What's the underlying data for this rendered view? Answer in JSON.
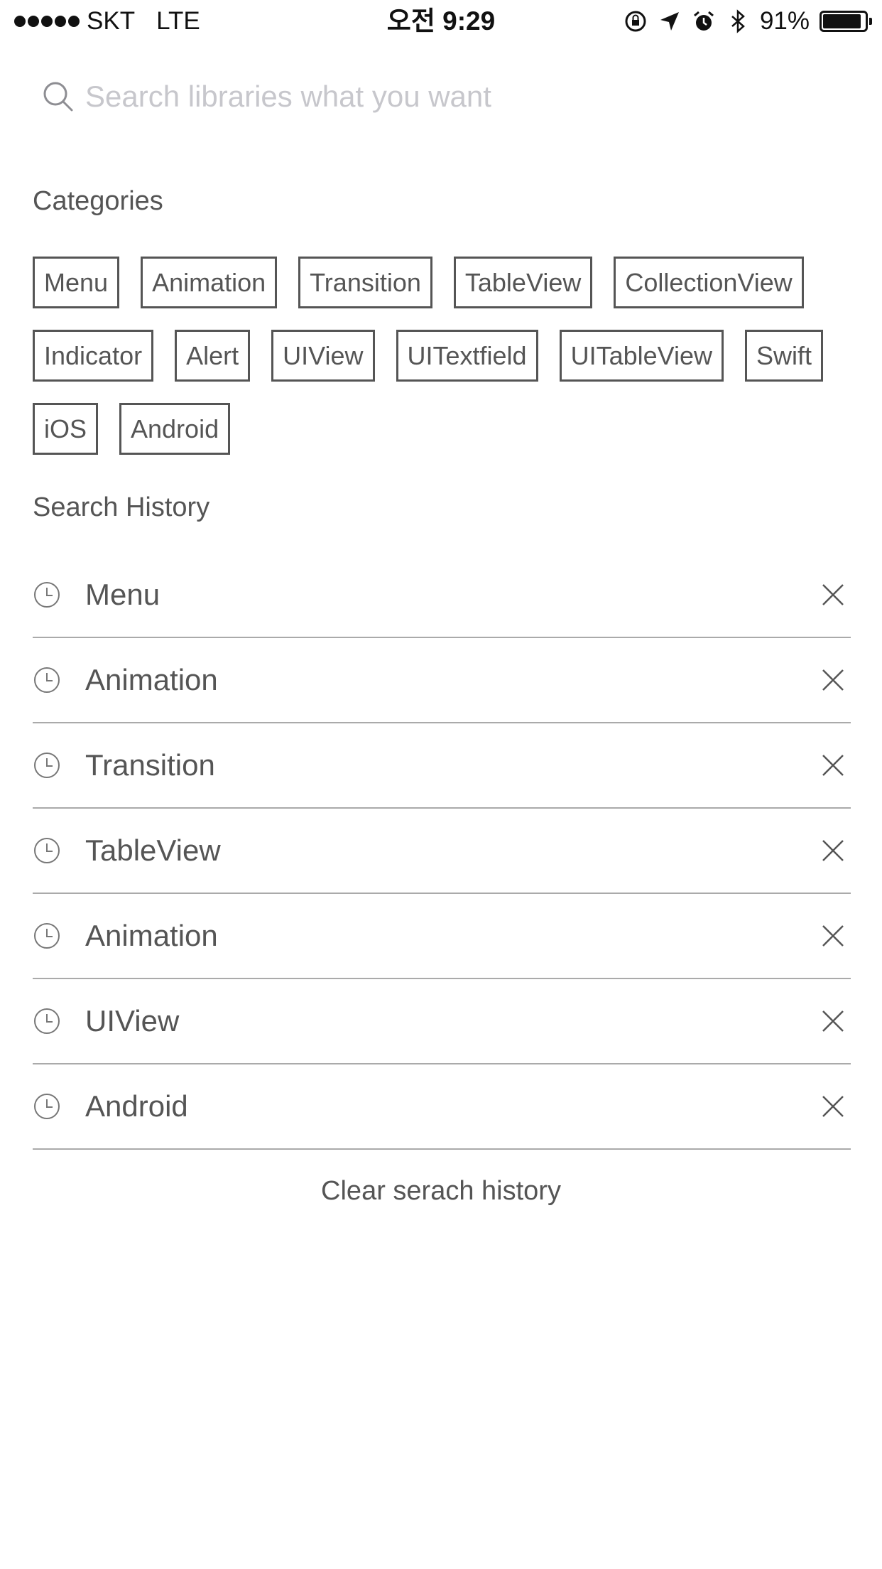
{
  "status_bar": {
    "carrier": "SKT",
    "network": "LTE",
    "time": "오전 9:29",
    "battery_text": "91%",
    "battery_level": 0.91,
    "icons": [
      "lock-rotation-icon",
      "location-arrow-icon",
      "alarm-icon",
      "bluetooth-icon",
      "battery-icon"
    ]
  },
  "search": {
    "placeholder": "Search libraries what you want",
    "value": ""
  },
  "categories": {
    "title": "Categories",
    "rows": [
      [
        "Menu",
        "Animation",
        "Transition",
        "TableView",
        "CollectionView"
      ],
      [
        "Indicator",
        "Alert",
        "UIView",
        "UITextfield",
        "UITableView",
        "Swift"
      ],
      [
        "iOS",
        "Android"
      ]
    ]
  },
  "history": {
    "title": "Search History",
    "items": [
      "Menu",
      "Animation",
      "Transition",
      "TableView",
      "Animation",
      "UIView",
      "Android"
    ],
    "clear_label": "Clear serach history"
  },
  "colors": {
    "text": "#555555",
    "placeholder": "#c7c7cc",
    "divider": "#aaaaaa"
  }
}
